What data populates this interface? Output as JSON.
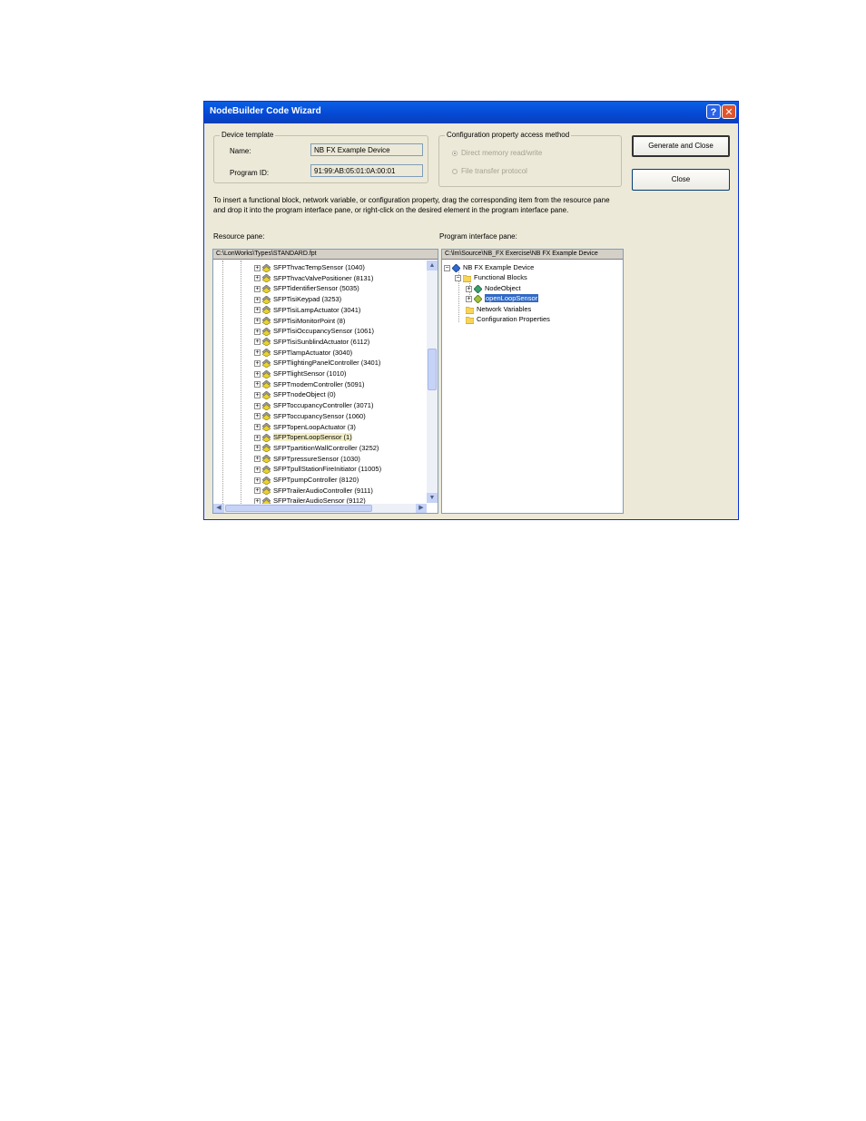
{
  "window": {
    "title": "NodeBuilder Code Wizard",
    "help_label": "?",
    "close_label": "✕"
  },
  "device_template": {
    "legend": "Device template",
    "name_label": "Name:",
    "name_value": "NB FX Example Device",
    "program_id_label": "Program ID:",
    "program_id_value": "91:99:AB:05:01:0A:00:01"
  },
  "config_access": {
    "legend": "Configuration property access method",
    "option_direct": "Direct memory read/write",
    "option_file": "File transfer protocol",
    "selected": "direct"
  },
  "buttons": {
    "generate_close": "Generate and Close",
    "close": "Close"
  },
  "instructions": "To insert a functional block, network variable, or configuration property, drag the corresponding item from the resource pane and drop it into the program interface pane, or right-click on the desired element in the program interface pane.",
  "resource_pane": {
    "label": "Resource pane:",
    "path": "C:\\LonWorks\\Types\\STANDARD.fpt",
    "items": [
      "SFPThvacTempSensor (1040)",
      "SFPThvacValvePositioner (8131)",
      "SFPTidentifierSensor (5035)",
      "SFPTisiKeypad (3253)",
      "SFPTisiLampActuator (3041)",
      "SFPTisiMonitorPoint (8)",
      "SFPTisiOccupancySensor (1061)",
      "SFPTisiSunblindActuator (6112)",
      "SFPTlampActuator (3040)",
      "SFPTlightingPanelController (3401)",
      "SFPTlightSensor (1010)",
      "SFPTmodemController (5091)",
      "SFPTnodeObject (0)",
      "SFPToccupancyController (3071)",
      "SFPToccupancySensor (1060)",
      "SFPTopenLoopActuator (3)",
      "SFPTopenLoopSensor (1)",
      "SFPTpartitionWallController (3252)",
      "SFPTpressureSensor (1030)",
      "SFPTpullStationFireInitiator (11005)",
      "SFPTpumpController (8120)",
      "SFPTrailerAudioController (9111)",
      "SFPTrailerAudioSensor (9112)"
    ],
    "highlighted_index": 16
  },
  "program_pane": {
    "label": "Program interface pane:",
    "path": "C:\\lm\\Source\\NB_FX Exercise\\NB FX Example Device",
    "root": "NB FX Example Device",
    "functional_blocks": "Functional Blocks",
    "node_object": "NodeObject",
    "open_loop_sensor": "openLoopSensor",
    "network_variables": "Network Variables",
    "config_properties": "Configuration Properties"
  },
  "colors": {
    "titlebar": "#0548d3",
    "selection": "#316ac5",
    "folder": "#f7d55a"
  }
}
